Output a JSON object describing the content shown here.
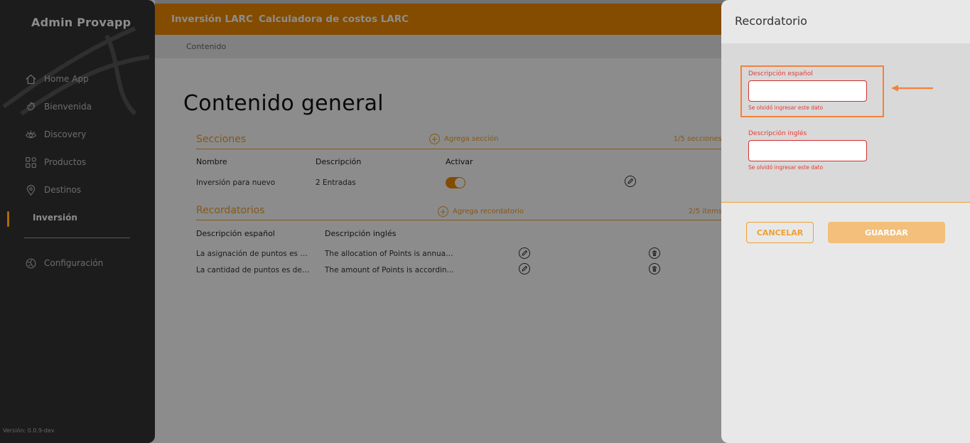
{
  "sidebar": {
    "brand": "Admin Provapp",
    "items": [
      {
        "label": "Home App",
        "icon": "home-icon"
      },
      {
        "label": "Bienvenida",
        "icon": "waving-hand-icon"
      },
      {
        "label": "Discovery",
        "icon": "eye-icon"
      },
      {
        "label": "Productos",
        "icon": "grid-icon"
      },
      {
        "label": "Destinos",
        "icon": "map-pin-icon"
      },
      {
        "label": "Inversión",
        "icon": ""
      }
    ],
    "settings": {
      "label": "Configuración",
      "icon": "settings-icon"
    },
    "version": "Versión: 0.0.9-dev"
  },
  "topbar": {
    "tabs": [
      "Inversión LARC",
      "Calculadora de costos LARC"
    ]
  },
  "breadcrumb": "Contenido",
  "page_title": "Contenido general",
  "secciones": {
    "title": "Secciones",
    "add_label": "Agrega sección",
    "count": "1/5 secciones",
    "headers": [
      "Nombre",
      "Descripción",
      "Activar"
    ],
    "rows": [
      {
        "nombre": "Inversión para nuevo",
        "descripcion": "2 Entradas",
        "activar": true
      }
    ]
  },
  "recordatorios": {
    "title": "Recordatorios",
    "add_label": "Agrega recordatorio",
    "count": "2/5 items",
    "headers": [
      "Descripción español",
      "Descripción inglés"
    ],
    "rows": [
      {
        "es": "La asignación de puntos es a...",
        "en": "The allocation of Points is annual ..."
      },
      {
        "es": "La cantidad de puntos es de ...",
        "en": "The amount of Points is accordin..."
      }
    ]
  },
  "panel": {
    "title": "Recordatorio",
    "fields": [
      {
        "label": "Descripción español",
        "value": "",
        "error": "Se olvidó ingresar este dato"
      },
      {
        "label": "Descripción inglés",
        "value": "",
        "error": "Se olvidó ingresar este dato"
      }
    ],
    "cancel_label": "CANCELAR",
    "save_label": "GUARDAR"
  },
  "colors": {
    "accent": "#f08a00",
    "error": "#e53935",
    "annotation": "#f4813a",
    "sidebar_bg": "#1c1c1c"
  }
}
